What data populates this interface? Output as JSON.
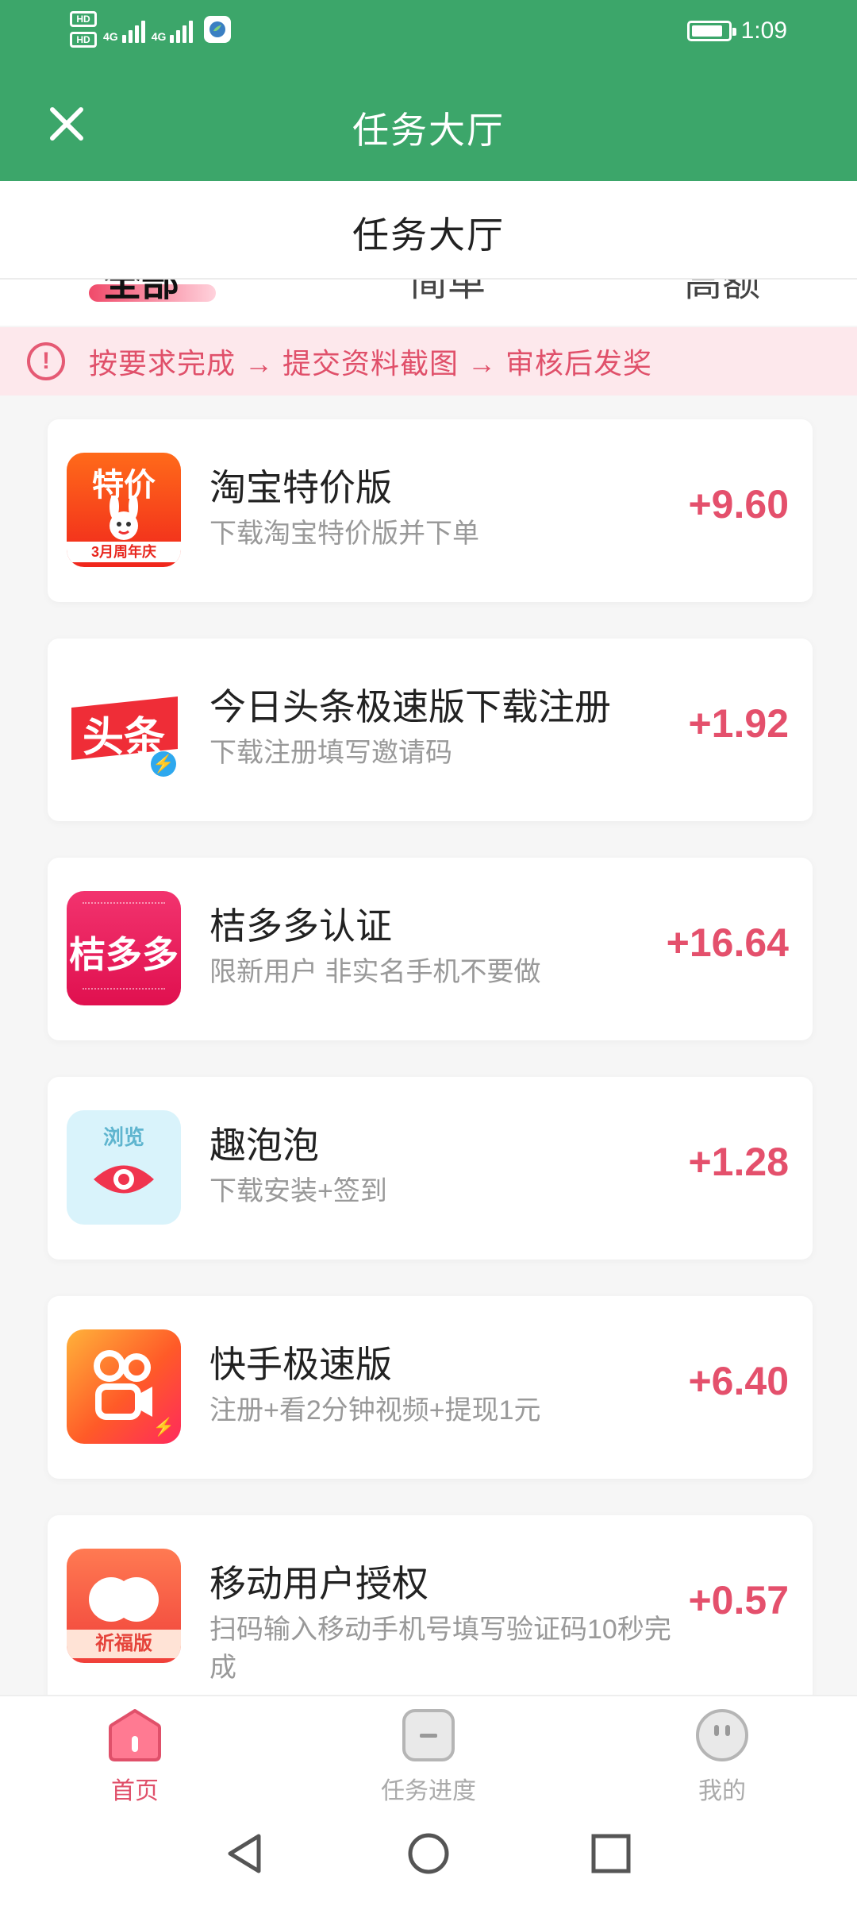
{
  "status_bar": {
    "time": "1:09",
    "hd_badges": [
      "HD",
      "HD"
    ],
    "network": [
      "4G",
      "4G"
    ]
  },
  "header": {
    "title": "任务大厅",
    "close_icon": "close-icon"
  },
  "subheader": {
    "title": "任务大厅"
  },
  "tabs": [
    {
      "label": "全部",
      "active": true
    },
    {
      "label": "简单",
      "active": false
    },
    {
      "label": "高额",
      "active": false
    }
  ],
  "notice": {
    "icon": "exclamation-circle-icon",
    "text": "按要求完成 → 提交资料截图 → 审核后发奖"
  },
  "tasks": [
    {
      "name": "淘宝特价版",
      "desc": "下载淘宝特价版并下单",
      "reward": "+9.60",
      "icon": "taobao-tejia-icon",
      "icon_text": "特价",
      "icon_sub": "3月周年庆"
    },
    {
      "name": "今日头条极速版下载注册",
      "desc": "下载注册填写邀请码",
      "reward": "+1.92",
      "icon": "toutiao-icon",
      "icon_text": "头条"
    },
    {
      "name": "桔多多认证",
      "desc": "限新用户 非实名手机不要做",
      "reward": "+16.64",
      "icon": "juduoduo-icon",
      "icon_text": "桔多多"
    },
    {
      "name": "趣泡泡",
      "desc": "下载安装+签到",
      "reward": "+1.28",
      "icon": "qupaopao-icon",
      "icon_text": "浏览"
    },
    {
      "name": "快手极速版",
      "desc": "注册+看2分钟视频+提现1元",
      "reward": "+6.40",
      "icon": "kuaishou-icon"
    },
    {
      "name": "移动用户授权",
      "desc": "扫码输入移动手机号填写验证码10秒完成",
      "reward": "+0.57",
      "icon": "qifu-icon",
      "icon_text": "祈福版"
    }
  ],
  "bottom_nav": [
    {
      "label": "首页",
      "icon": "home-icon",
      "active": true
    },
    {
      "label": "任务进度",
      "icon": "task-progress-icon",
      "active": false
    },
    {
      "label": "我的",
      "icon": "profile-face-icon",
      "active": false
    }
  ],
  "colors": {
    "brand_green": "#3ca66a",
    "accent_pink": "#e4506c",
    "notice_bg": "#fde8ec"
  }
}
